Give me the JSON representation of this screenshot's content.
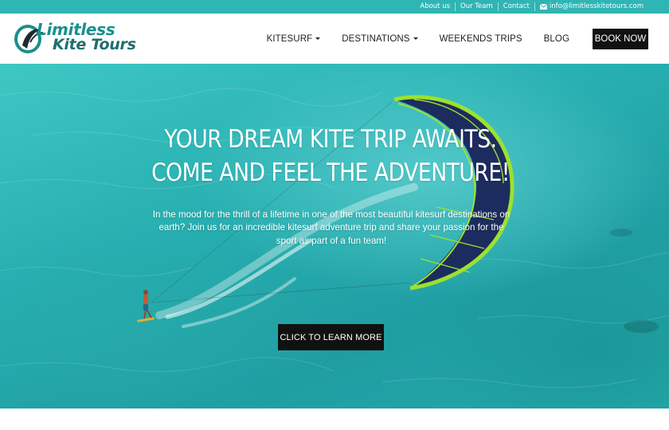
{
  "topbar": {
    "links": [
      "About us",
      "Our Team",
      "Contact"
    ],
    "email": "info@limitlesskitetours.com"
  },
  "logo": {
    "line1": "Limitless",
    "line2": "Kite Tours"
  },
  "nav": {
    "items": [
      {
        "label": "KITESURF",
        "has_dropdown": true
      },
      {
        "label": "DESTINATIONS",
        "has_dropdown": true
      },
      {
        "label": "WEEKENDS TRIPS",
        "has_dropdown": false
      },
      {
        "label": "BLOG",
        "has_dropdown": false
      }
    ],
    "book_label": "BOOK NOW"
  },
  "hero": {
    "title_line1": "YOUR DREAM KITE TRIP AWAITS.",
    "title_line2": "COME AND FEEL THE ADVENTURE!",
    "subtitle": "In the mood for the thrill of a lifetime in one of the most beautiful kitesurf destinations on earth? Join us for an incredible kitesurf adventure trip and share your passion for the sport as part of a fun team!",
    "cta_label": "CLICK TO LEARN MORE"
  },
  "colors": {
    "accent": "#2fb5b4",
    "logo_teal": "#1a8f8c",
    "button_dark": "#111111",
    "kite_navy": "#1d2c5e",
    "kite_green": "#9be22f"
  },
  "icons": {
    "email": "envelope-icon",
    "dropdown": "caret-down-icon"
  }
}
